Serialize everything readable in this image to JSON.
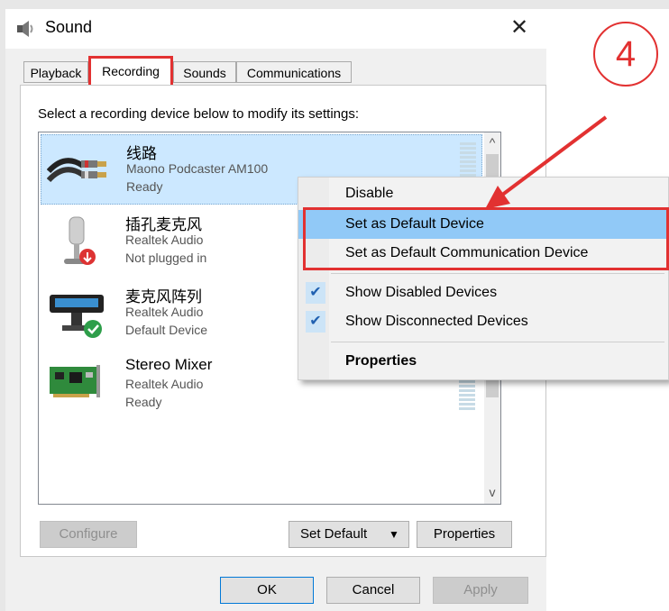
{
  "window": {
    "title": "Sound",
    "close_glyph": "✕"
  },
  "annotation": {
    "step_number": "4",
    "color": "#e23131"
  },
  "tabs": [
    {
      "label": "Playback"
    },
    {
      "label": "Recording",
      "active": true
    },
    {
      "label": "Sounds"
    },
    {
      "label": "Communications"
    }
  ],
  "instruction": "Select a recording device below to modify its settings:",
  "devices": [
    {
      "name": "线路",
      "subtitle": "Maono Podcaster AM100",
      "status": "Ready",
      "icon": "line-in-cable-icon",
      "selected": true
    },
    {
      "name": "插孔麦克风",
      "subtitle": "Realtek Audio",
      "status": "Not plugged in",
      "icon": "microphone-jack-icon",
      "badge": "down-arrow-badge-icon"
    },
    {
      "name": "麦克风阵列",
      "subtitle": "Realtek Audio",
      "status": "Default Device",
      "icon": "microphone-array-icon",
      "badge": "check-badge-icon"
    },
    {
      "name": "Stereo Mixer",
      "subtitle": "Realtek Audio",
      "status": "Ready",
      "icon": "sound-card-icon"
    }
  ],
  "scrollbar": {
    "up": "^",
    "down": "v"
  },
  "buttons": {
    "configure": "Configure",
    "set_default": "Set Default",
    "set_default_arrow": "▼",
    "properties": "Properties",
    "ok": "OK",
    "cancel": "Cancel",
    "apply": "Apply"
  },
  "context_menu": {
    "items": [
      {
        "label": "Disable"
      },
      {
        "label": "Set as Default Device",
        "highlighted": true
      },
      {
        "label": "Set as Default Communication Device"
      },
      {
        "label": "Show Disabled Devices",
        "checked": true
      },
      {
        "label": "Show Disconnected Devices",
        "checked": true
      },
      {
        "label": "Properties",
        "bold": true
      }
    ],
    "check_glyph": "✔"
  },
  "colors": {
    "selection": "#cce8ff",
    "menu_highlight": "#91c9f7",
    "accent": "#0078d7"
  }
}
